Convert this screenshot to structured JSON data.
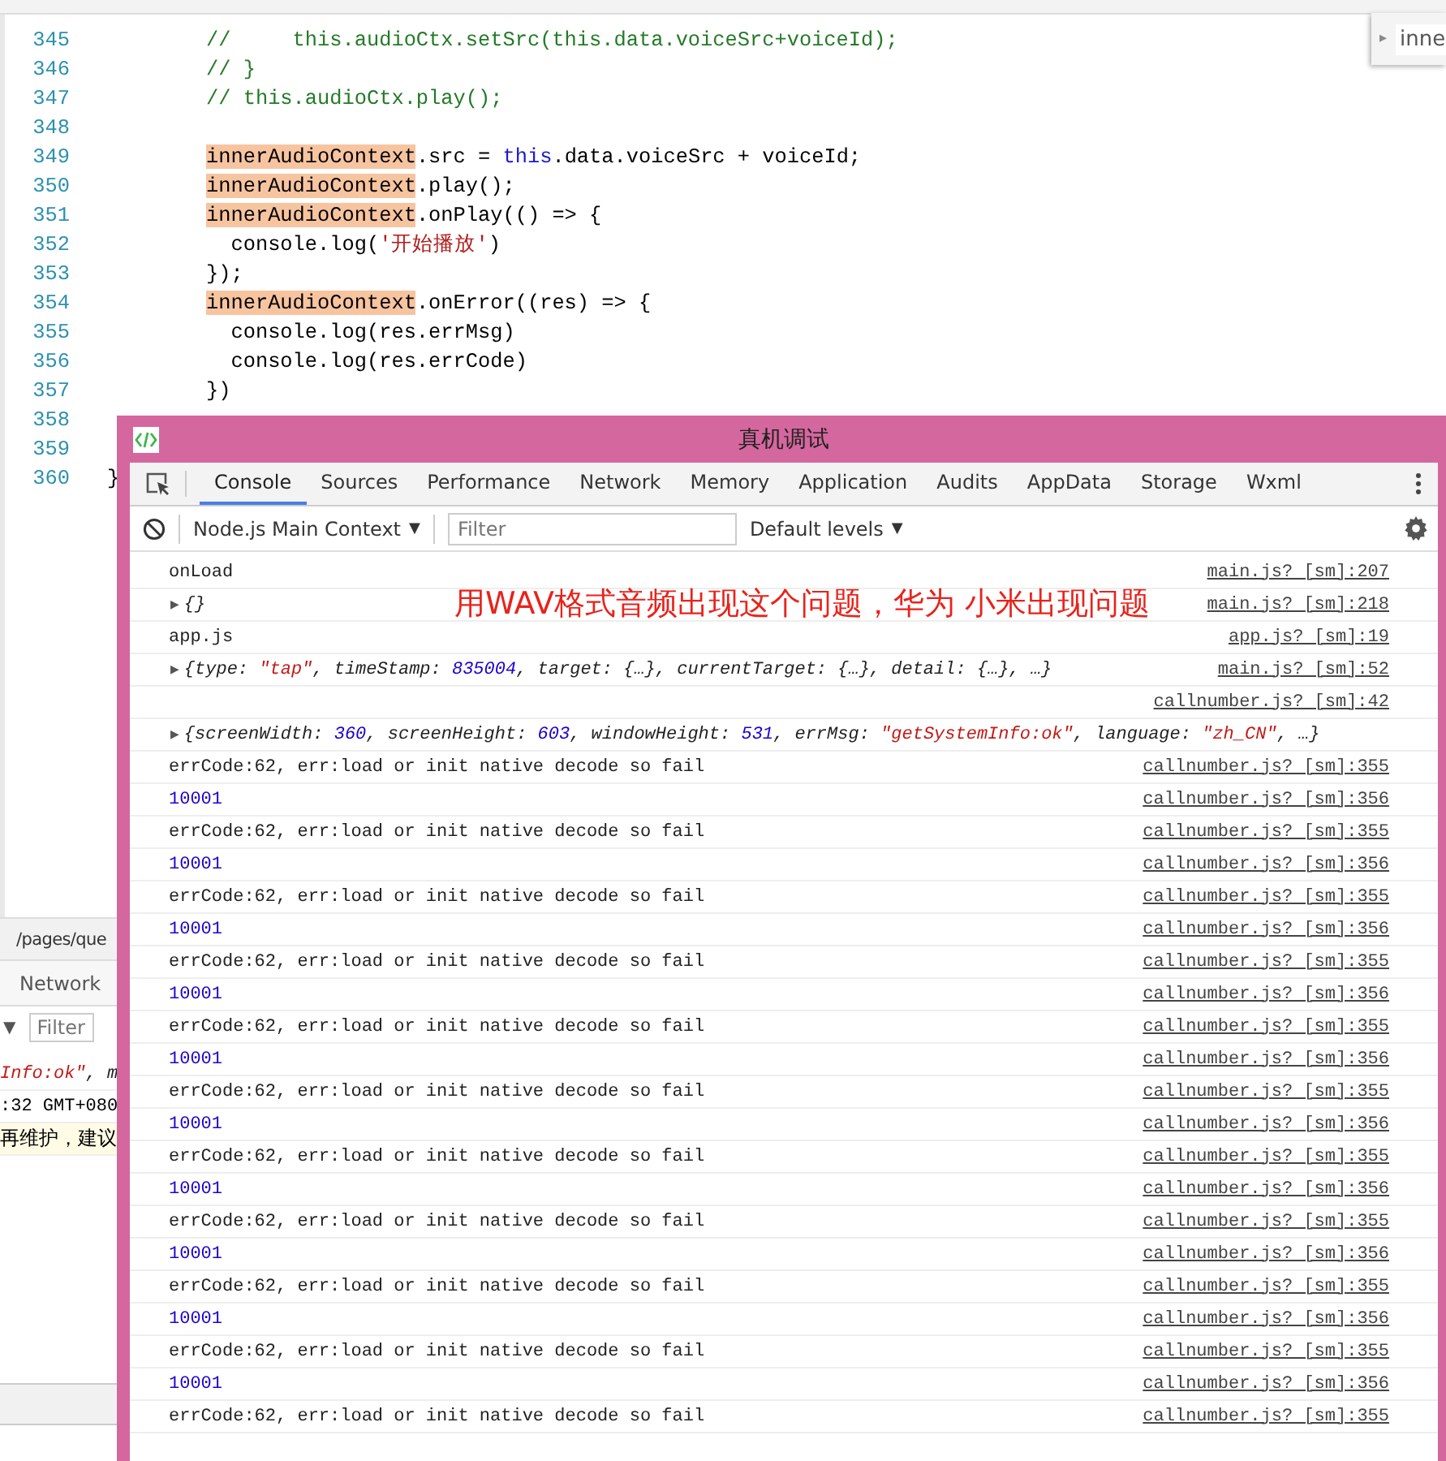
{
  "editor": {
    "lines": [
      {
        "number": "345",
        "kind": "body",
        "parts": [
          {
            "kind": "comment",
            "text": "//     this.audioCtx.setSrc(this.data.voiceSrc+voiceId);"
          }
        ]
      },
      {
        "number": "346",
        "kind": "body",
        "parts": [
          {
            "kind": "comment",
            "text": "// }"
          }
        ]
      },
      {
        "number": "347",
        "kind": "body",
        "parts": [
          {
            "kind": "comment",
            "text": "// this.audioCtx.play();"
          }
        ]
      },
      {
        "number": "348"
      },
      {
        "number": "349",
        "kind": "body",
        "parts": [
          {
            "kind": "highlight",
            "text": "innerAudioContext"
          },
          {
            "kind": "plain",
            "text": ".src = "
          },
          {
            "kind": "keyword",
            "text": "this"
          },
          {
            "kind": "plain",
            "text": ".data.voiceSrc + voiceId;"
          }
        ]
      },
      {
        "number": "350",
        "kind": "body",
        "parts": [
          {
            "kind": "highlight",
            "text": "innerAudioContext"
          },
          {
            "kind": "plain",
            "text": ".play();"
          }
        ]
      },
      {
        "number": "351",
        "kind": "body",
        "parts": [
          {
            "kind": "highlight",
            "text": "innerAudioContext"
          },
          {
            "kind": "plain",
            "text": ".onPlay(() => {"
          }
        ]
      },
      {
        "number": "352",
        "kind": "body",
        "parts": [
          {
            "kind": "plain",
            "text": "  console.log("
          },
          {
            "kind": "string",
            "text": "'开始播放'"
          },
          {
            "kind": "plain",
            "text": ")"
          }
        ]
      },
      {
        "number": "353",
        "kind": "body",
        "parts": [
          {
            "kind": "plain",
            "text": "});"
          }
        ]
      },
      {
        "number": "354",
        "kind": "body",
        "parts": [
          {
            "kind": "highlight",
            "text": "innerAudioContext"
          },
          {
            "kind": "plain",
            "text": ".onError((res) => {"
          }
        ]
      },
      {
        "number": "355",
        "kind": "body",
        "parts": [
          {
            "kind": "plain",
            "text": "  console.log(res.errMsg)"
          }
        ]
      },
      {
        "number": "356",
        "kind": "body",
        "parts": [
          {
            "kind": "plain",
            "text": "  console.log(res.errCode)"
          }
        ]
      },
      {
        "number": "357",
        "kind": "body",
        "parts": [
          {
            "kind": "plain",
            "text": "})"
          }
        ]
      },
      {
        "number": "358"
      },
      {
        "number": "359"
      },
      {
        "number": "360",
        "kind": "outer",
        "parts": [
          {
            "kind": "plain",
            "text": "}"
          }
        ]
      }
    ]
  },
  "search_panel": {
    "toggle": "▸",
    "text": "inne"
  },
  "background_panel": {
    "path": "/pages/que",
    "tab": "Network",
    "dropdown": "▼",
    "filter": {
      "placeholder": "Filter"
    },
    "log_lines": [
      {
        "highlighted": false,
        "parts": [
          {
            "kind": "obj_string",
            "text": "Info:ok\""
          },
          {
            "kind": "obj",
            "text": ", m"
          }
        ]
      },
      {
        "highlighted": false,
        "parts": [
          {
            "kind": "plain",
            "text": ":32 GMT+080"
          }
        ]
      },
      {
        "highlighted": true,
        "parts": [
          {
            "kind": "plain",
            "text": "再维护，建议"
          }
        ]
      }
    ]
  },
  "devtools": {
    "title": "真机调试",
    "tabs": [
      {
        "label": "Console",
        "selected": true
      },
      {
        "label": "Sources",
        "selected": false
      },
      {
        "label": "Performance",
        "selected": false
      },
      {
        "label": "Network",
        "selected": false
      },
      {
        "label": "Memory",
        "selected": false
      },
      {
        "label": "Application",
        "selected": false
      },
      {
        "label": "Audits",
        "selected": false
      },
      {
        "label": "AppData",
        "selected": false
      },
      {
        "label": "Storage",
        "selected": false
      },
      {
        "label": "Wxml",
        "selected": false
      }
    ],
    "context": "Node.js Main Context",
    "context_arrow": "▼",
    "filter": {
      "placeholder": "Filter"
    },
    "levels": "Default levels",
    "levels_arrow": "▼",
    "annotation": "用WAV格式音频出现这个问题，华为 小米出现问题",
    "rows": [
      {
        "parts": [
          {
            "kind": "plain",
            "text": "onLoad"
          }
        ],
        "source": "main.js? [sm]:207"
      },
      {
        "toggle": "▶",
        "parts": [
          {
            "kind": "obj",
            "text": "{}"
          }
        ],
        "source": "main.js? [sm]:218"
      },
      {
        "parts": [
          {
            "kind": "plain",
            "text": "app.js"
          }
        ],
        "source": "app.js? [sm]:19"
      },
      {
        "toggle": "▶",
        "parts": [
          {
            "kind": "obj",
            "text": "{type: "
          },
          {
            "kind": "obj_string",
            "text": "\"tap\""
          },
          {
            "kind": "obj",
            "text": ", timeStamp: "
          },
          {
            "kind": "obj_number",
            "text": "835004"
          },
          {
            "kind": "obj",
            "text": ", target: {…}, currentTarget: {…}, detail: {…}, …}"
          }
        ],
        "source": "main.js? [sm]:52"
      },
      {
        "source": "callnumber.js? [sm]:42"
      },
      {
        "toggle": "▶",
        "parts": [
          {
            "kind": "obj",
            "text": "{screenWidth: "
          },
          {
            "kind": "obj_number",
            "text": "360"
          },
          {
            "kind": "obj",
            "text": ", screenHeight: "
          },
          {
            "kind": "obj_number",
            "text": "603"
          },
          {
            "kind": "obj",
            "text": ", windowHeight: "
          },
          {
            "kind": "obj_number",
            "text": "531"
          },
          {
            "kind": "obj",
            "text": ", errMsg: "
          },
          {
            "kind": "obj_string",
            "text": "\"getSystemInfo:ok\""
          },
          {
            "kind": "obj",
            "text": ", language: "
          },
          {
            "kind": "obj_string",
            "text": "\"zh_CN\""
          },
          {
            "kind": "obj",
            "text": ", …}"
          }
        ]
      },
      {
        "parts": [
          {
            "kind": "plain",
            "text": "errCode:62, err:load or init native decode so fail"
          }
        ],
        "source": "callnumber.js? [sm]:355"
      },
      {
        "parts": [
          {
            "kind": "number",
            "text": "10001"
          }
        ],
        "source": "callnumber.js? [sm]:356"
      },
      {
        "parts": [
          {
            "kind": "plain",
            "text": "errCode:62, err:load or init native decode so fail"
          }
        ],
        "source": "callnumber.js? [sm]:355"
      },
      {
        "parts": [
          {
            "kind": "number",
            "text": "10001"
          }
        ],
        "source": "callnumber.js? [sm]:356"
      },
      {
        "parts": [
          {
            "kind": "plain",
            "text": "errCode:62, err:load or init native decode so fail"
          }
        ],
        "source": "callnumber.js? [sm]:355"
      },
      {
        "parts": [
          {
            "kind": "number",
            "text": "10001"
          }
        ],
        "source": "callnumber.js? [sm]:356"
      },
      {
        "parts": [
          {
            "kind": "plain",
            "text": "errCode:62, err:load or init native decode so fail"
          }
        ],
        "source": "callnumber.js? [sm]:355"
      },
      {
        "parts": [
          {
            "kind": "number",
            "text": "10001"
          }
        ],
        "source": "callnumber.js? [sm]:356"
      },
      {
        "parts": [
          {
            "kind": "plain",
            "text": "errCode:62, err:load or init native decode so fail"
          }
        ],
        "source": "callnumber.js? [sm]:355"
      },
      {
        "parts": [
          {
            "kind": "number",
            "text": "10001"
          }
        ],
        "source": "callnumber.js? [sm]:356"
      },
      {
        "parts": [
          {
            "kind": "plain",
            "text": "errCode:62, err:load or init native decode so fail"
          }
        ],
        "source": "callnumber.js? [sm]:355"
      },
      {
        "parts": [
          {
            "kind": "number",
            "text": "10001"
          }
        ],
        "source": "callnumber.js? [sm]:356"
      },
      {
        "parts": [
          {
            "kind": "plain",
            "text": "errCode:62, err:load or init native decode so fail"
          }
        ],
        "source": "callnumber.js? [sm]:355"
      },
      {
        "parts": [
          {
            "kind": "number",
            "text": "10001"
          }
        ],
        "source": "callnumber.js? [sm]:356"
      },
      {
        "parts": [
          {
            "kind": "plain",
            "text": "errCode:62, err:load or init native decode so fail"
          }
        ],
        "source": "callnumber.js? [sm]:355"
      },
      {
        "parts": [
          {
            "kind": "number",
            "text": "10001"
          }
        ],
        "source": "callnumber.js? [sm]:356"
      },
      {
        "parts": [
          {
            "kind": "plain",
            "text": "errCode:62, err:load or init native decode so fail"
          }
        ],
        "source": "callnumber.js? [sm]:355"
      },
      {
        "parts": [
          {
            "kind": "number",
            "text": "10001"
          }
        ],
        "source": "callnumber.js? [sm]:356"
      },
      {
        "parts": [
          {
            "kind": "plain",
            "text": "errCode:62, err:load or init native decode so fail"
          }
        ],
        "source": "callnumber.js? [sm]:355"
      },
      {
        "parts": [
          {
            "kind": "number",
            "text": "10001"
          }
        ],
        "source": "callnumber.js? [sm]:356"
      },
      {
        "parts": [
          {
            "kind": "plain",
            "text": "errCode:62, err:load or init native decode so fail"
          }
        ],
        "source": "callnumber.js? [sm]:355"
      }
    ]
  }
}
